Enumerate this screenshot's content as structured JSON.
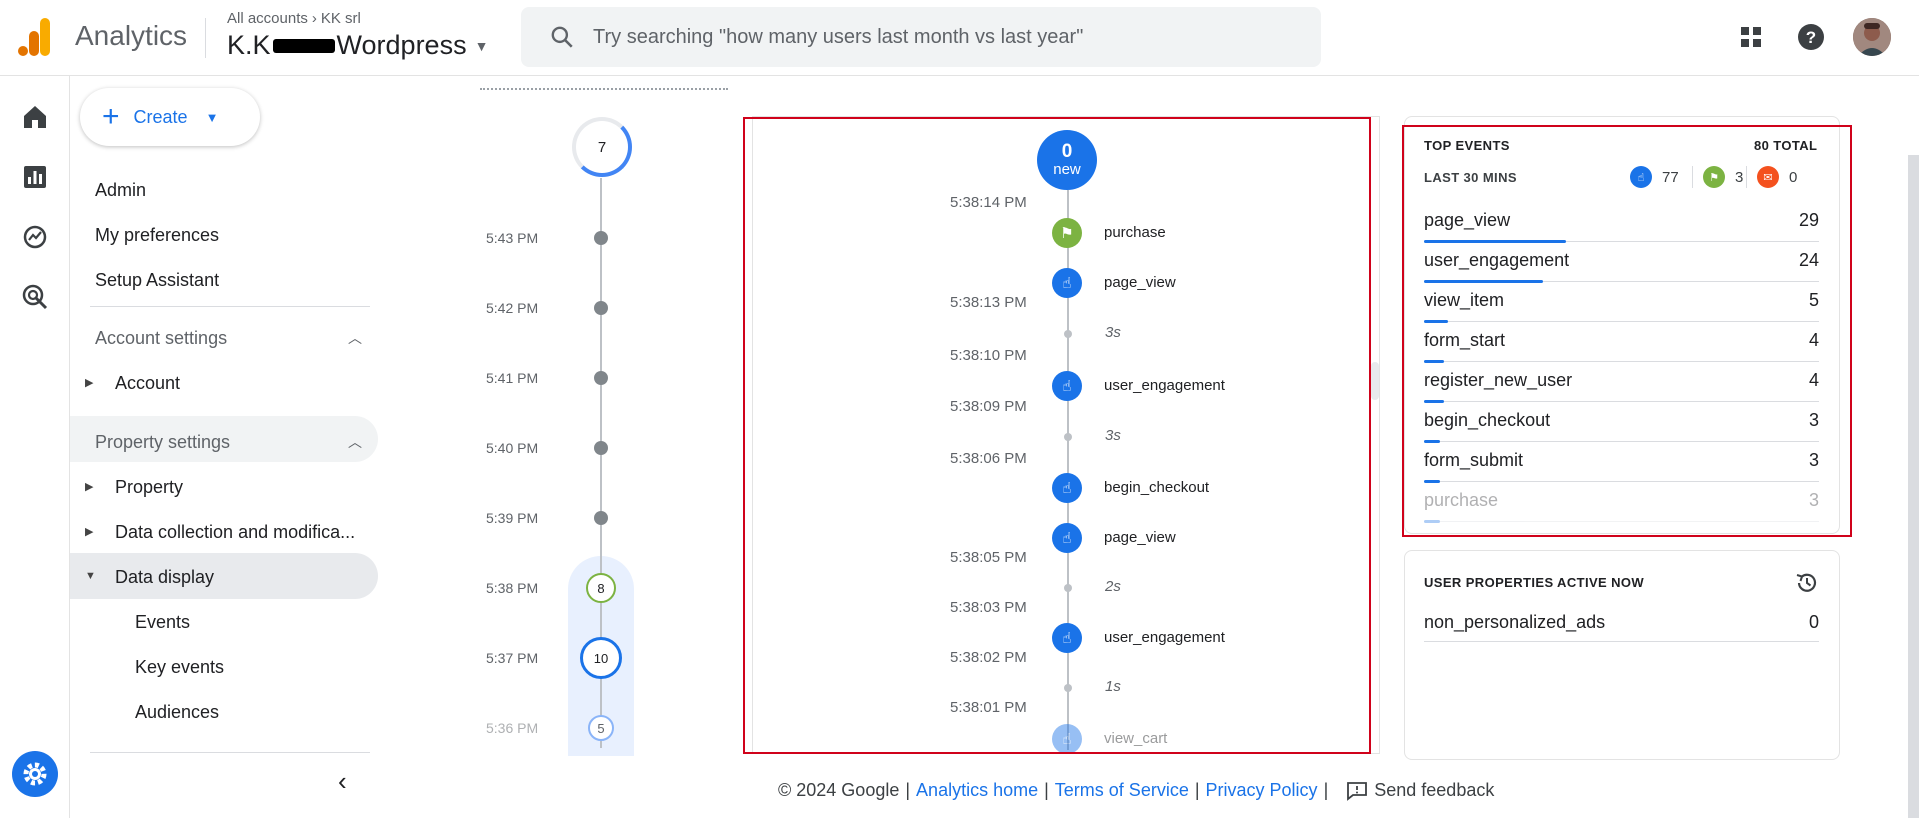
{
  "header": {
    "app_name": "Analytics",
    "breadcrumb_accounts": "All accounts",
    "breadcrumb_account": "KK srl",
    "property_prefix": "K.K",
    "property_suffix": "Wordpress",
    "search_placeholder": "Try searching \"how many users last month vs last year\""
  },
  "nav": {
    "create_label": "Create",
    "admin": "Admin",
    "my_preferences": "My preferences",
    "setup_assistant": "Setup Assistant",
    "account_settings": "Account settings",
    "account": "Account",
    "property_settings": "Property settings",
    "property": "Property",
    "data_collection": "Data collection and modifica...",
    "data_display": "Data display",
    "events": "Events",
    "key_events": "Key events",
    "audiences": "Audiences"
  },
  "minutes": {
    "top_count": "7",
    "times": [
      "5:43 PM",
      "5:42 PM",
      "5:41 PM",
      "5:40 PM",
      "5:39 PM",
      "5:38 PM",
      "5:37 PM",
      "5:36 PM"
    ],
    "badge_538": "8",
    "badge_537": "10",
    "badge_536": "5"
  },
  "stream": {
    "new_count": "0",
    "new_label": "new",
    "times": [
      "5:38:14 PM",
      "5:38:13 PM",
      "5:38:10 PM",
      "5:38:09 PM",
      "5:38:06 PM",
      "5:38:05 PM",
      "5:38:03 PM",
      "5:38:02 PM",
      "5:38:01 PM"
    ],
    "events": [
      "purchase",
      "page_view",
      "user_engagement",
      "begin_checkout",
      "page_view",
      "user_engagement",
      "view_cart"
    ],
    "gaps": [
      "3s",
      "3s",
      "2s",
      "1s"
    ]
  },
  "top_events": {
    "title": "TOP EVENTS",
    "total": "80 TOTAL",
    "subtitle": "LAST 30 MINS",
    "count_user": "77",
    "count_key": "3",
    "count_conv": "0",
    "rows": [
      {
        "name": "page_view",
        "value": "29",
        "share": 0.36
      },
      {
        "name": "user_engagement",
        "value": "24",
        "share": 0.3
      },
      {
        "name": "view_item",
        "value": "5",
        "share": 0.06
      },
      {
        "name": "form_start",
        "value": "4",
        "share": 0.05
      },
      {
        "name": "register_new_user",
        "value": "4",
        "share": 0.05
      },
      {
        "name": "begin_checkout",
        "value": "3",
        "share": 0.04
      },
      {
        "name": "form_submit",
        "value": "3",
        "share": 0.04
      },
      {
        "name": "purchase",
        "value": "3",
        "share": 0.04
      }
    ]
  },
  "user_properties": {
    "title": "USER PROPERTIES ACTIVE NOW",
    "row_name": "non_personalized_ads",
    "row_value": "0"
  },
  "footer": {
    "copyright": "© 2024 Google",
    "analytics_home": "Analytics home",
    "terms": "Terms of Service",
    "privacy": "Privacy Policy",
    "feedback": "Send feedback"
  },
  "colors": {
    "accent": "#1a73e8",
    "key_event": "#7cb342",
    "conversion": "#f4511e",
    "highlight_box": "#d0021b"
  }
}
